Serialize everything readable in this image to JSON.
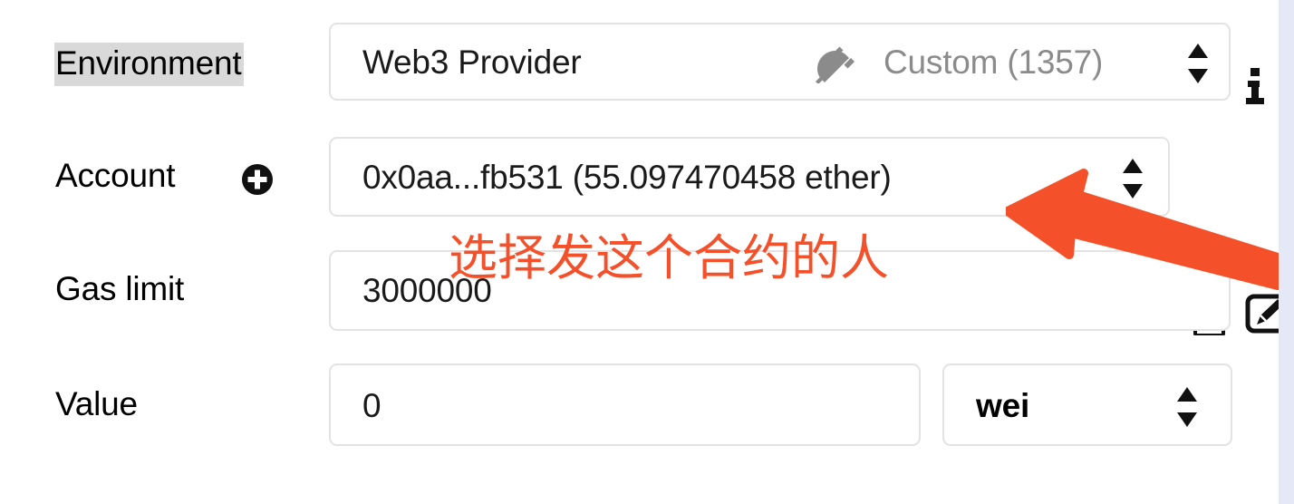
{
  "colors": {
    "background": "#ffffff",
    "panel_edge": "#e5e8f6",
    "field_border": "#e3e3e3",
    "label_highlight": "#d9d9d9",
    "muted_text": "#8b8b8b",
    "annotation_red": "#f4502a"
  },
  "form": {
    "environment": {
      "label": "Environment",
      "provider": "Web3 Provider",
      "network": "Custom (1357)",
      "plug_icon": "plug-icon",
      "stepper_icon": "spinner-arrows-icon",
      "info_icon": "info-icon"
    },
    "account": {
      "label": "Account",
      "add_icon": "plus-circle-icon",
      "value": "0x0aa...fb531 (55.097470458 ether)",
      "stepper_icon": "spinner-arrows-icon",
      "copy_icon": "copy-icon",
      "sign_icon": "sign-message-icon"
    },
    "gas_limit": {
      "label": "Gas limit",
      "value": "3000000"
    },
    "value": {
      "label": "Value",
      "value": "0",
      "unit": "wei",
      "stepper_icon": "spinner-arrows-icon"
    }
  },
  "annotation": {
    "text": "选择发这个合约的人",
    "arrow": "arrow-pointing-up-left"
  }
}
